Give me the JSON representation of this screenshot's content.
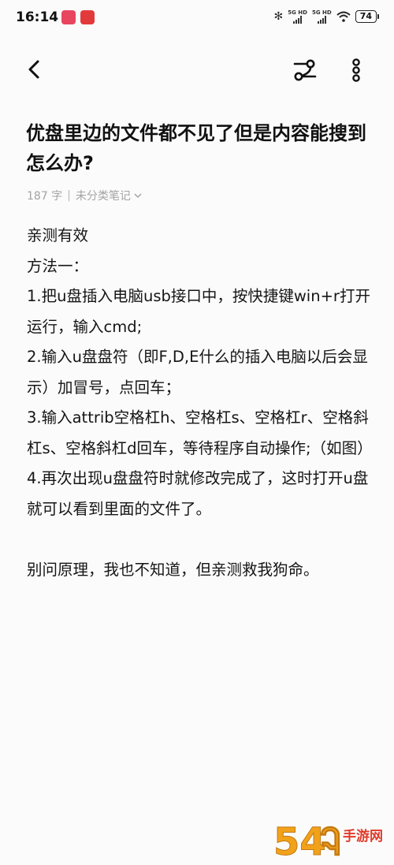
{
  "status_bar": {
    "time": "16:14",
    "network_1": "5G HD",
    "network_2": "5G HD",
    "battery": "74",
    "colors": {
      "badge_1": "#e8455f",
      "badge_2": "#e23a3a"
    }
  },
  "nav": {
    "back_icon": "chevron-left-icon",
    "share_icon": "share-nodes-icon",
    "more_icon": "more-vertical-icon"
  },
  "note": {
    "title": "优盘里边的文件都不见了但是内容能搜到怎么办?",
    "word_count": "187 字",
    "separator": "|",
    "category": "未分类笔记",
    "lines": [
      "亲测有效",
      "方法一：",
      "1.把u盘插入电脑usb接口中，按快捷键win+r打开运行，输入cmd;",
      "2.输入u盘盘符（即F,D,E什么的插入电脑以后会显示）加冒号，点回车；",
      "3.输入attrib空格杠h、空格杠s、空格杠r、空格斜杠s、空格斜杠d回车，等待程序自动操作;（如图）",
      "4.再次出现u盘盘符时就修改完成了，这时打开u盘就可以看到里面的文件了。",
      "",
      "别问原理，我也不知道，但亲测救我狗命。"
    ]
  },
  "watermark": {
    "text_1": "54",
    "text_2": "手游网"
  }
}
